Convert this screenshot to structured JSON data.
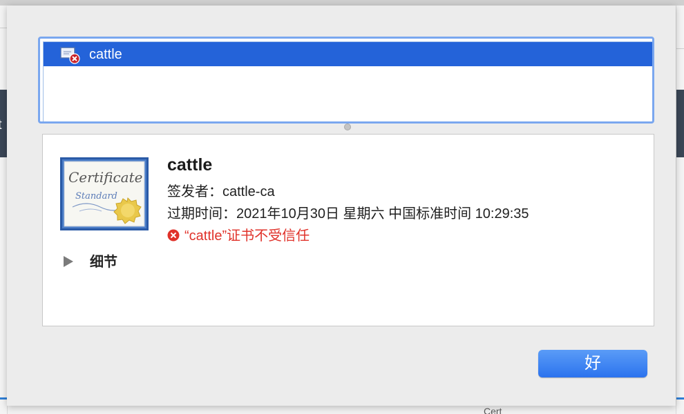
{
  "background": {
    "left_text": "t",
    "bottom_text": "Cert"
  },
  "cert_list": {
    "items": [
      {
        "label": "cattle",
        "icon": "certificate-error-icon",
        "selected": true
      }
    ]
  },
  "details": {
    "title": "cattle",
    "issuer_label": "签发者：",
    "issuer_value": "cattle-ca",
    "expires_label": "过期时间：",
    "expires_value": "2021年10月30日 星期六 中国标准时间 10:29:35",
    "status_text": "“cattle”证书不受信任",
    "status_icon": "error-x-circle-icon",
    "toggle_label": "细节",
    "cert_image_text": [
      "Certificate",
      "Standard"
    ]
  },
  "buttons": {
    "ok_label": "好"
  },
  "colors": {
    "selection": "#2463d9",
    "error": "#e0322a",
    "button": "#2c73ee"
  }
}
